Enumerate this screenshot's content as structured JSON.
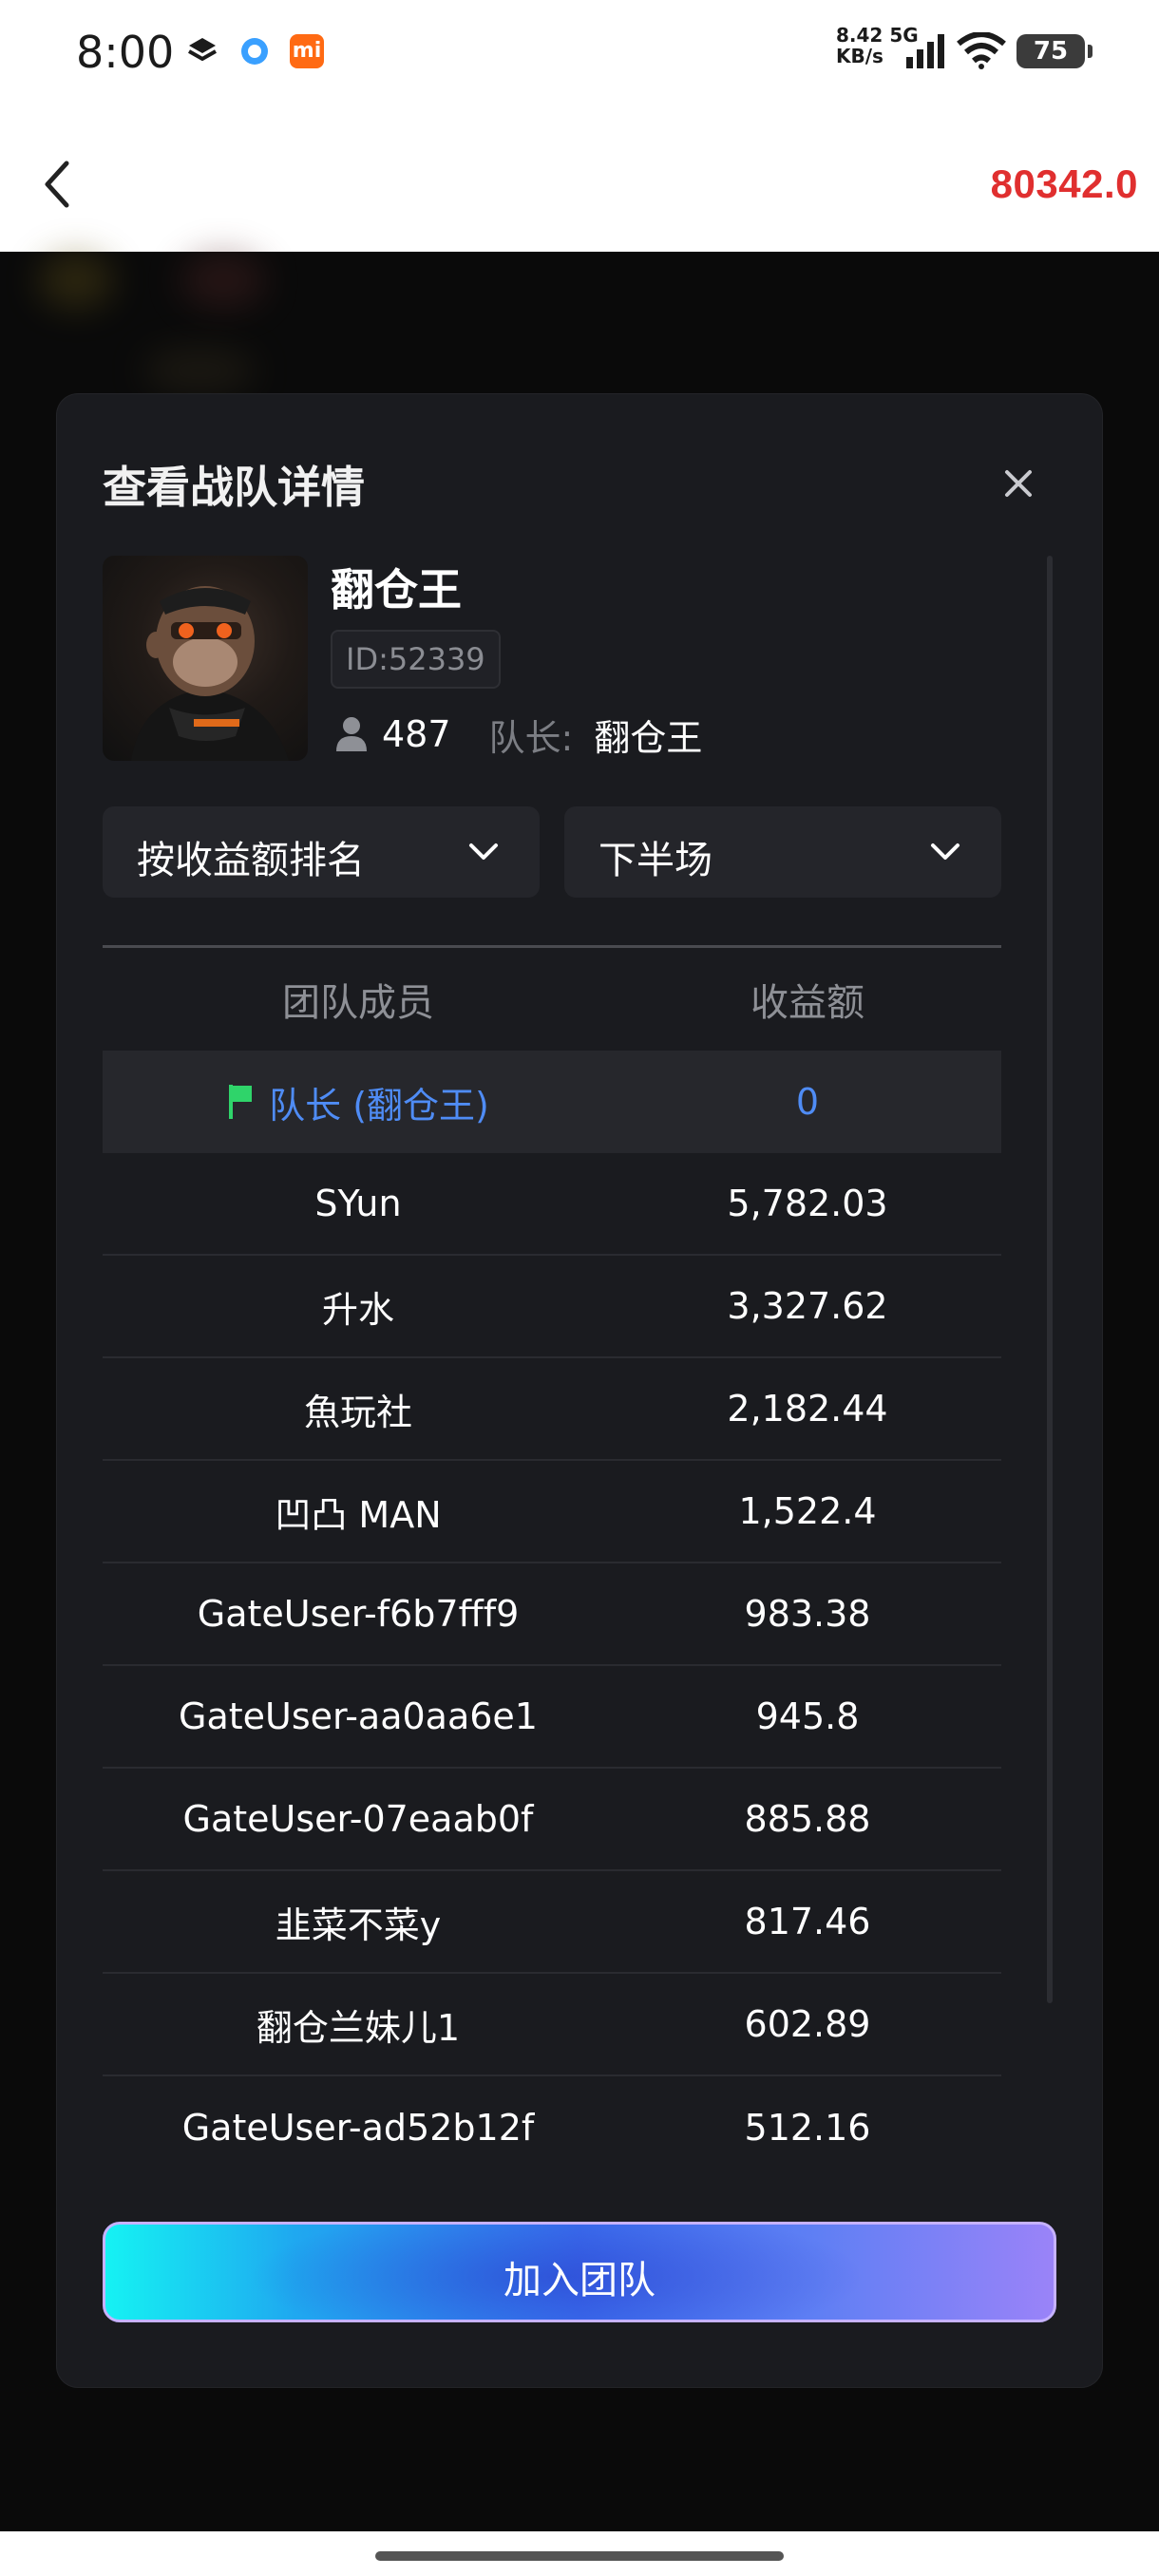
{
  "status_bar": {
    "time": "8:00",
    "net_speed": "8.42",
    "net_unit": "KB/s",
    "net_type": "5G",
    "battery": "75",
    "mi_badge": "mi"
  },
  "header": {
    "back_icon": "chevron-left-icon",
    "balance": "80342.0",
    "balance_color": "#e02f2f"
  },
  "modal": {
    "title": "查看战队详情",
    "close_icon": "close-icon",
    "team": {
      "name": "翻仓王",
      "id": "ID:52339",
      "member_count": "487",
      "leader_label": "队长:",
      "leader_name": "翻仓王"
    },
    "filters": {
      "sort_label": "按收益额排名",
      "half_label": "下半场"
    },
    "table": {
      "headers": [
        "团队成员",
        "收益额"
      ],
      "leader_row": {
        "name": "队长 (翻仓王)",
        "value": "0"
      },
      "rows": [
        {
          "name": "SYun",
          "value": "5,782.03"
        },
        {
          "name": "升水",
          "value": "3,327.62"
        },
        {
          "name": "魚玩社",
          "value": "2,182.44"
        },
        {
          "name": "凹凸 MAN",
          "value": "1,522.4"
        },
        {
          "name": "GateUser-f6b7fff9",
          "value": "983.38"
        },
        {
          "name": "GateUser-aa0aa6e1",
          "value": "945.8"
        },
        {
          "name": "GateUser-07eaab0f",
          "value": "885.88"
        },
        {
          "name": "韭菜不菜y",
          "value": "817.46"
        },
        {
          "name": "翻仓兰妹儿1",
          "value": "602.89"
        },
        {
          "name": "GateUser-ad52b12f",
          "value": "512.16"
        }
      ]
    },
    "join_button": "加入团队"
  },
  "colors": {
    "accent_blue": "#4f8cf5",
    "flag_green": "#2fd46a",
    "modal_bg": "#1a1b1f"
  }
}
